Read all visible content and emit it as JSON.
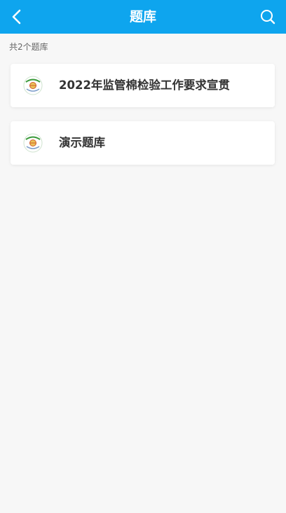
{
  "header": {
    "title": "题库",
    "back_icon": "chevron-left-icon",
    "search_icon": "search-icon",
    "color": "#0ea5ee"
  },
  "list": {
    "count_label": "共2个题库",
    "items": [
      {
        "label": "2022年监管棉检验工作要求宣贯",
        "icon": "bank-logo-icon"
      },
      {
        "label": "演示题库",
        "icon": "bank-logo-icon"
      }
    ]
  }
}
